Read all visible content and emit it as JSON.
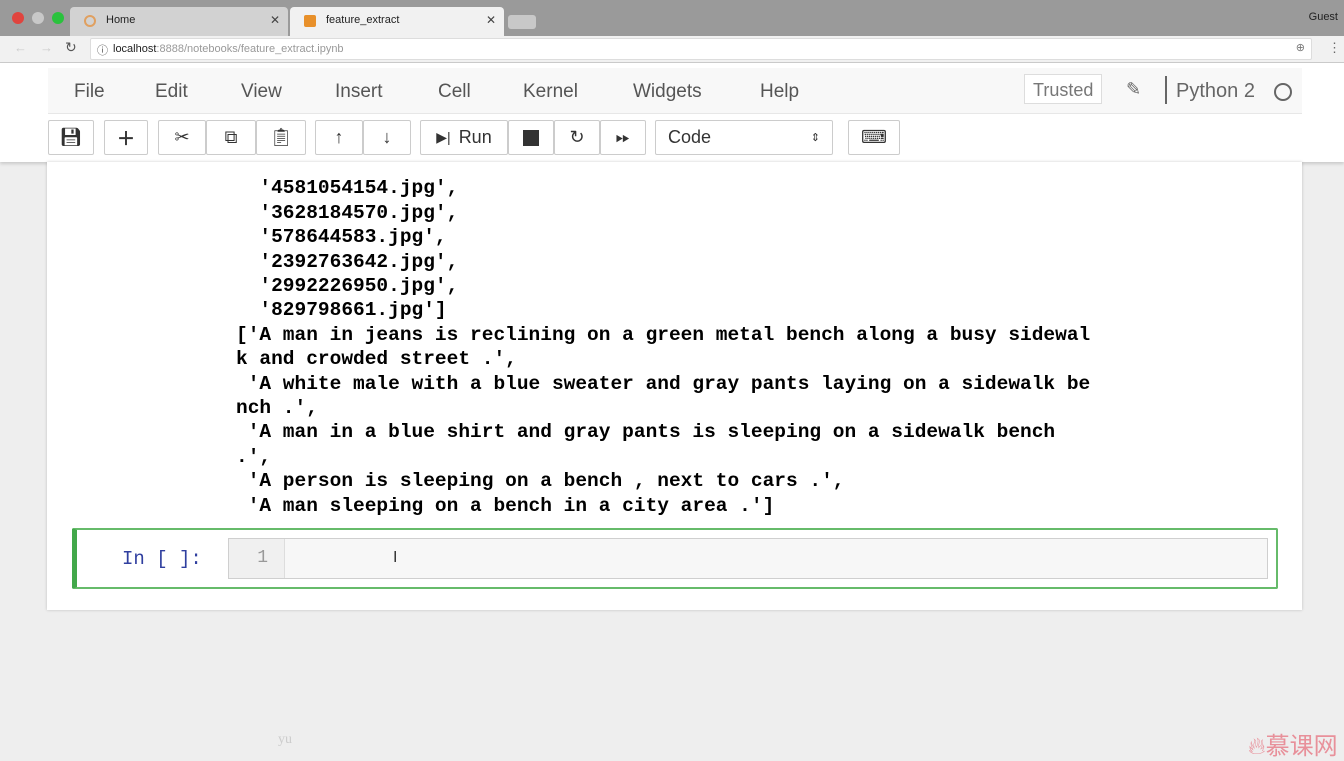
{
  "browser": {
    "tabs": [
      {
        "label": "Home"
      },
      {
        "label": "feature_extract"
      }
    ],
    "url_host": "localhost",
    "url_rest": ":8888/notebooks/feature_extract.ipynb",
    "profile": "Guest"
  },
  "menu": [
    "File",
    "Edit",
    "View",
    "Insert",
    "Cell",
    "Kernel",
    "Widgets",
    "Help"
  ],
  "status": {
    "trusted": "Trusted",
    "kernel": "Python 2"
  },
  "toolbar": {
    "run": "Run",
    "cell_type": "Code"
  },
  "output": [
    "  '4581054154.jpg',",
    "  '3628184570.jpg',",
    "  '578644583.jpg',",
    "  '2392763642.jpg',",
    "  '2992226950.jpg',",
    "  '829798661.jpg']",
    "['A man in jeans is reclining on a green metal bench along a busy sidewal",
    "k and crowded street .',",
    " 'A white male with a blue sweater and gray pants laying on a sidewalk be",
    "nch .',",
    " 'A man in a blue shirt and gray pants is sleeping on a sidewalk bench",
    ".',",
    " 'A person is sleeping on a bench , next to cars .',",
    " 'A man sleeping on a bench in a city area .']"
  ],
  "cell": {
    "prompt": "In [ ]:",
    "line_number": "1"
  },
  "footer_text": "yu",
  "watermark": "慕课网",
  "colors": {
    "cell_border": "#66bb6a",
    "prompt": "#303f9f"
  }
}
